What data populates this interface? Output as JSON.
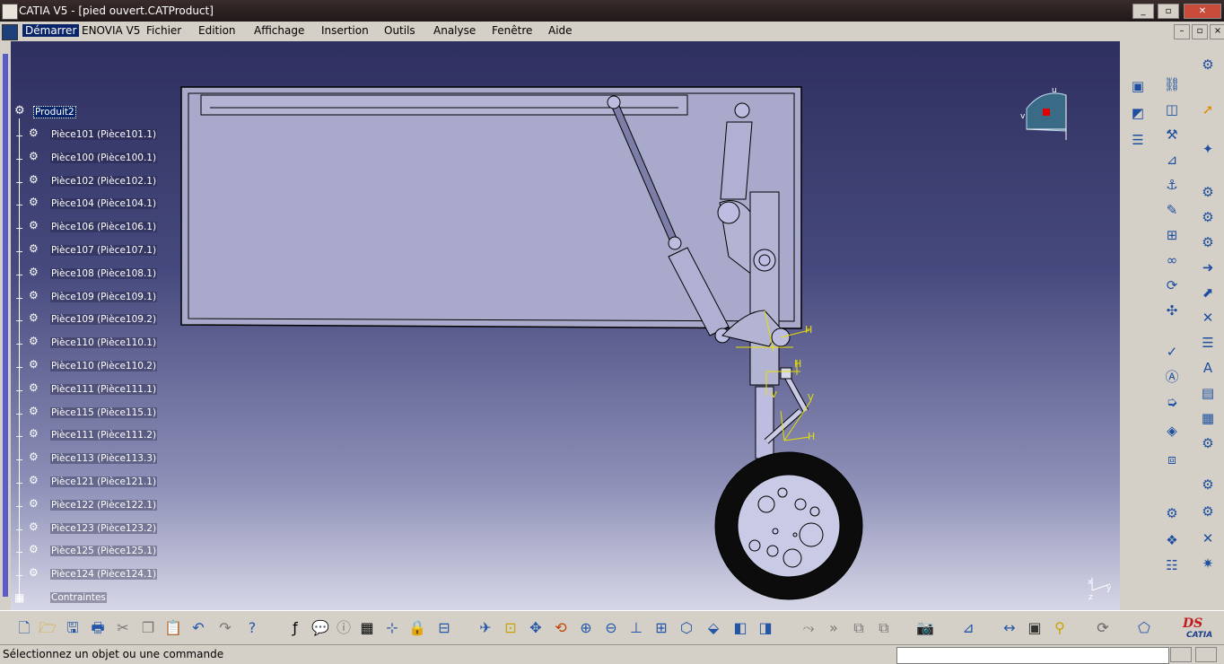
{
  "window": {
    "title": "CATIA V5 - [pied ouvert.CATProduct]"
  },
  "menu": [
    "Démarrer",
    "ENOVIA V5",
    "Fichier",
    "Edition",
    "Affichage",
    "Insertion",
    "Outils",
    "Analyse",
    "Fenêtre",
    "Aide"
  ],
  "tree": {
    "root": "Produit2",
    "items": [
      "Pièce101 (Pièce101.1)",
      "Pièce100 (Pièce100.1)",
      "Pièce102 (Pièce102.1)",
      "Pièce104 (Pièce104.1)",
      "Pièce106 (Pièce106.1)",
      "Pièce107 (Pièce107.1)",
      "Pièce108 (Pièce108.1)",
      "Pièce109 (Pièce109.1)",
      "Pièce109 (Pièce109.2)",
      "Pièce110 (Pièce110.1)",
      "Pièce110 (Pièce110.2)",
      "Pièce111 (Pièce111.1)",
      "Pièce115 (Pièce115.1)",
      "Pièce111 (Pièce111.2)",
      "Pièce113 (Pièce113.3)",
      "Pièce121 (Pièce121.1)",
      "Pièce122 (Pièce122.1)",
      "Pièce123 (Pièce123.2)",
      "Pièce125 (Pièce125.1)",
      "Pièce124 (Pièce124.1)"
    ],
    "constraints": "Contraintes"
  },
  "constraint_marks": {
    "h1": "H",
    "h2": "H",
    "v1": "V",
    "v2": "V",
    "h3": "H"
  },
  "axis": {
    "x": "x",
    "y": "y",
    "z": "z"
  },
  "compass": {
    "u": "u",
    "v": "v"
  },
  "brand": "CATIA",
  "status": {
    "message": "Sélectionnez un objet ou une commande",
    "command_input": ""
  },
  "colors": {
    "selection": "#0a246a",
    "part_fill": "#b6b7d8",
    "constraint": "#e8e000"
  }
}
